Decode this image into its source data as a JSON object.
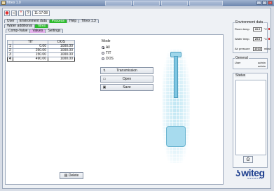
{
  "titlebar": {
    "title": "Titrex 1.0"
  },
  "toolbar": {
    "time": "11:17:08"
  },
  "tabs_row1": [
    "User",
    "Environment data",
    "Process",
    "Help",
    "Titrex 1.3"
  ],
  "tabs_row2": [
    "Water additional",
    "Titrex"
  ],
  "tabs_row3": [
    "Comp-Value",
    "Values",
    "Settings"
  ],
  "table": {
    "headers": [
      "",
      "TIT",
      "DOS"
    ],
    "rows": [
      {
        "idx": "1",
        "tit": "0.00",
        "dos": "1000.00"
      },
      {
        "idx": "2",
        "tit": "250.00",
        "dos": "1000.00"
      },
      {
        "idx": "3",
        "tit": "150.00",
        "dos": "1000.00"
      },
      {
        "idx": "4",
        "tit": "490.00",
        "dos": "1000.00"
      }
    ]
  },
  "mode": {
    "label": "Mode",
    "options": [
      "All",
      "TIT",
      "DOS"
    ],
    "selected": "All"
  },
  "buttons": {
    "transmission": "Transmission",
    "open": "Open",
    "save": "Save",
    "delete": "Delete"
  },
  "environment": {
    "title": "Environment data",
    "room_temp_label": "Room temp.",
    "room_temp_value": "20.0",
    "room_temp_unit": "°C",
    "water_temp_label": "Water temp.",
    "water_temp_value": "20.0",
    "water_temp_unit": "°C",
    "air_pressure_label": "Air pressure",
    "air_pressure_value": "1013",
    "air_pressure_unit": "mbar"
  },
  "general": {
    "title": "General",
    "user_label": "User",
    "user_value": "admin",
    "user_value2": "admin"
  },
  "status": {
    "title": "Status"
  },
  "logo": {
    "text": "witeg",
    "sub": "GERMANY"
  },
  "colors": {
    "green_tab": "#2dbb2d",
    "purple_tab": "#e6b3ee",
    "brand": "#1e3f8f"
  }
}
